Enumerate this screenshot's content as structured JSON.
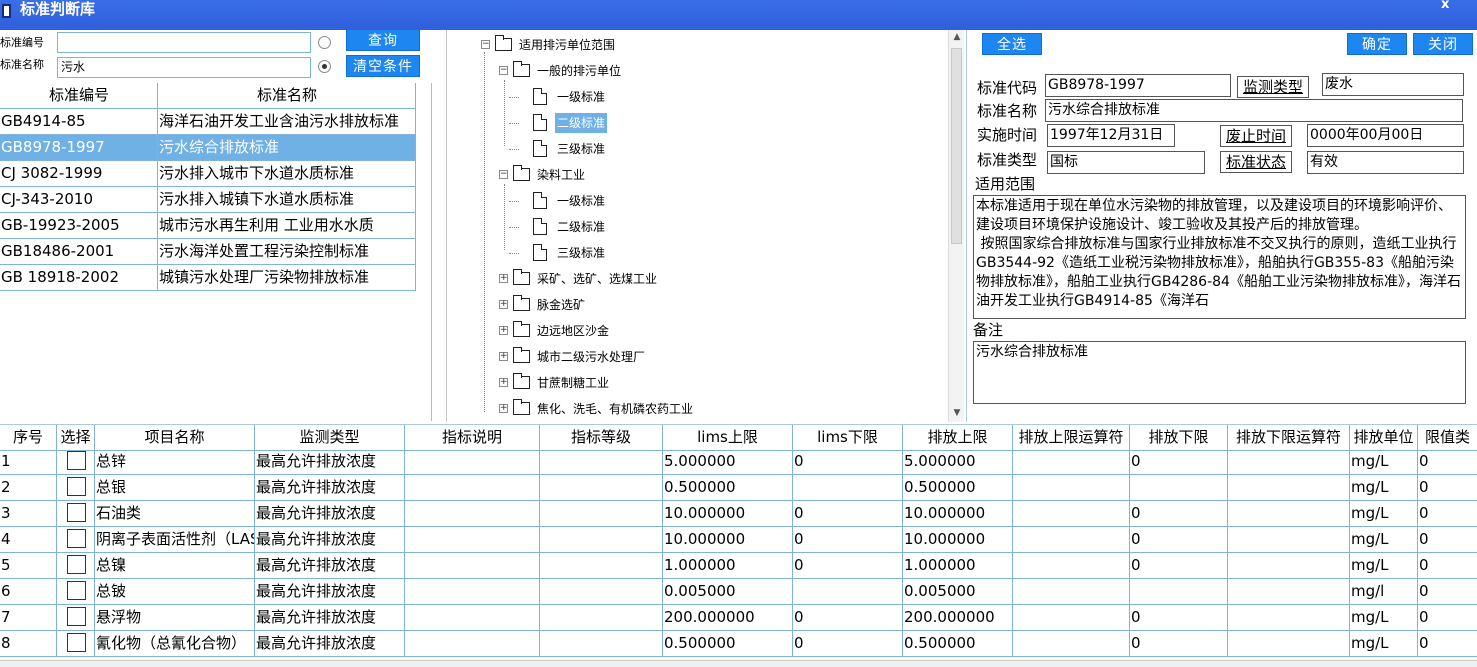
{
  "window": {
    "title": "标准判断库",
    "close": "x"
  },
  "search": {
    "code_label": "标准编号",
    "code_value": "",
    "name_label": "标准名称",
    "name_value": "污水",
    "query_button": "查询",
    "clear_button": "清空条件",
    "selected_radio": "name"
  },
  "left_grid": {
    "headers": [
      "标准编号",
      "标准名称"
    ],
    "selected_index": 1,
    "rows": [
      [
        "GB4914-85",
        "海洋石油开发工业含油污水排放标准"
      ],
      [
        "GB8978-1997",
        "污水综合排放标准"
      ],
      [
        "CJ 3082-1999",
        "污水排入城市下水道水质标准"
      ],
      [
        "CJ-343-2010",
        "污水排入城镇下水道水质标准"
      ],
      [
        "GB-19923-2005",
        "城市污水再生利用 工业用水水质"
      ],
      [
        "GB18486-2001",
        "污水海洋处置工程污染控制标准"
      ],
      [
        "GB 18918-2002",
        "城镇污水处理厂污染物排放标准"
      ]
    ]
  },
  "tree": {
    "root": "适用排污单位范围",
    "nodes": [
      {
        "label": "一般的排污单位",
        "type": "folder",
        "level": 1,
        "expanded": true
      },
      {
        "label": "一级标准",
        "type": "doc",
        "level": 2
      },
      {
        "label": "二级标准",
        "type": "doc",
        "level": 2,
        "selected": true
      },
      {
        "label": "三级标准",
        "type": "doc",
        "level": 2
      },
      {
        "label": "染料工业",
        "type": "folder",
        "level": 1,
        "expanded": true
      },
      {
        "label": "一级标准",
        "type": "doc",
        "level": 2
      },
      {
        "label": "二级标准",
        "type": "doc",
        "level": 2
      },
      {
        "label": "三级标准",
        "type": "doc",
        "level": 2
      },
      {
        "label": "采矿、选矿、选煤工业",
        "type": "folder",
        "level": 1,
        "expanded": false
      },
      {
        "label": "脉金选矿",
        "type": "folder",
        "level": 1,
        "expanded": false
      },
      {
        "label": "边远地区沙金",
        "type": "folder",
        "level": 1,
        "expanded": false
      },
      {
        "label": "城市二级污水处理厂",
        "type": "folder",
        "level": 1,
        "expanded": false
      },
      {
        "label": "甘蔗制糖工业",
        "type": "folder",
        "level": 1,
        "expanded": false
      },
      {
        "label": "焦化、洗毛、有机磷农药工业",
        "type": "folder",
        "level": 1,
        "expanded": false
      }
    ]
  },
  "right_panel": {
    "select_all": "全选",
    "confirm": "确定",
    "close": "关闭",
    "code_label": "标准代码",
    "code_value": "GB8978-1997",
    "monitor_type_label": "监测类型",
    "monitor_type_value": "废水",
    "name_label": "标准名称",
    "name_value": "污水综合排放标准",
    "impl_date_label": "实施时间",
    "impl_date_value": "1997年12月31日",
    "abolish_label": "废止时间",
    "abolish_value": "0000年00月00日",
    "type_label": "标准类型",
    "type_value": "国标",
    "status_label": "标准状态",
    "status_value": "有效",
    "scope_label": "适用范围",
    "scope_text": "本标准适用于现在单位水污染物的排放管理，以及建设项目的环境影响评价、建设项目环境保护设施设计、竣工验收及其投产后的排放管理。\n 按照国家综合排放标准与国家行业排放标准不交叉执行的原则，造纸工业执行GB3544-92《造纸工业税污染物排放标准》，船舶执行GB355-83《船舶污染物排放标准》，船舶工业执行GB4286-84《船舶工业污染物排放标准》，海洋石油开发工业执行GB4914-85《海洋石",
    "remark_label": "备注",
    "remark_text": "污水综合排放标准"
  },
  "bottom_grid": {
    "headers": [
      "序号",
      "选择",
      "项目名称",
      "监测类型",
      "指标说明",
      "指标等级",
      "lims上限",
      "lims下限",
      "排放上限",
      "排放上限运算符",
      "排放下限",
      "排放下限运算符",
      "排放单位",
      "限值类"
    ],
    "rows": [
      [
        "1",
        "",
        "总锌",
        "最高允许排放浓度",
        "",
        "",
        "5.000000",
        "0",
        "5.000000",
        "",
        "0",
        "",
        "mg/L",
        "0"
      ],
      [
        "2",
        "",
        "总银",
        "最高允许排放浓度",
        "",
        "",
        "0.500000",
        "",
        "0.500000",
        "",
        "",
        "",
        "mg/L",
        "0"
      ],
      [
        "3",
        "",
        "石油类",
        "最高允许排放浓度",
        "",
        "",
        "10.000000",
        "0",
        "10.000000",
        "",
        "0",
        "",
        "mg/L",
        "0"
      ],
      [
        "4",
        "",
        "阴离子表面活性剂（LAS）",
        "最高允许排放浓度",
        "",
        "",
        "10.000000",
        "0",
        "10.000000",
        "",
        "0",
        "",
        "mg/L",
        "0"
      ],
      [
        "5",
        "",
        "总镍",
        "最高允许排放浓度",
        "",
        "",
        "1.000000",
        "0",
        "1.000000",
        "",
        "0",
        "",
        "mg/L",
        "0"
      ],
      [
        "6",
        "",
        "总铍",
        "最高允许排放浓度",
        "",
        "",
        "0.005000",
        "",
        "0.005000",
        "",
        "",
        "",
        "mg/l",
        "0"
      ],
      [
        "7",
        "",
        "悬浮物",
        "最高允许排放浓度",
        "",
        "",
        "200.000000",
        "0",
        "200.000000",
        "",
        "0",
        "",
        "mg/L",
        "0"
      ],
      [
        "8",
        "",
        "氰化物（总氰化合物）",
        "最高允许排放浓度",
        "",
        "",
        "0.500000",
        "0",
        "0.500000",
        "",
        "0",
        "",
        "mg/L",
        "0"
      ]
    ]
  }
}
